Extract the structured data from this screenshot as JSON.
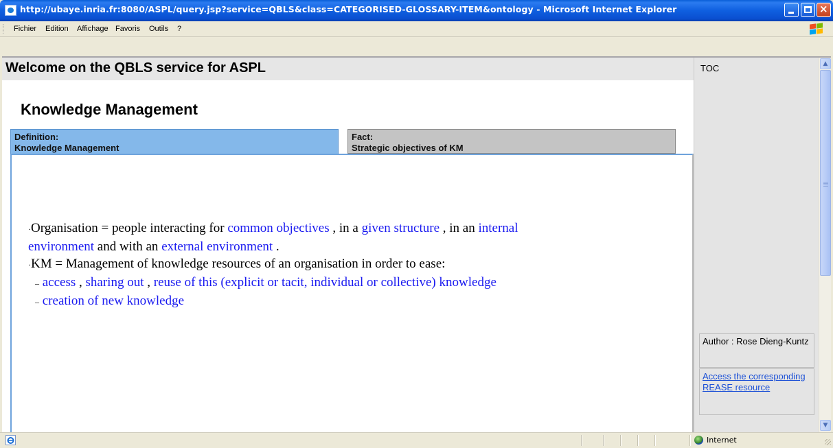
{
  "window": {
    "title": "http://ubaye.inria.fr:8080/ASPL/query.jsp?service=QBLS&class=CATEGORISED-GLOSSARY-ITEM&ontology - Microsoft Internet Explorer"
  },
  "menu": {
    "items": [
      "Fichier",
      "Edition",
      "Affichage",
      "Favoris",
      "Outils",
      "?"
    ]
  },
  "page": {
    "title": "Welcome on the QBLS service for ASPL",
    "subtitle": "Knowledge Management",
    "tabs": [
      {
        "kind": "Definition:",
        "name": "Knowledge Management",
        "active": true
      },
      {
        "kind": "Fact:",
        "name": "Strategic objectives of KM",
        "active": false
      }
    ]
  },
  "content": {
    "bullet": "·",
    "dash": "–",
    "line1": {
      "t1": "Organisation = people interacting for ",
      "l1": "common objectives",
      "t2": " , in a ",
      "l2": "given structure",
      "t3": " , in an ",
      "l3": "internal"
    },
    "line2": {
      "l1": "environment",
      "t1": " and with an ",
      "l2": "external environment",
      "t2": " ."
    },
    "line3": {
      "t1": "KM = Management of knowledge resources of an organisation in order to ease:"
    },
    "line4": {
      "l1": "access",
      "t1": " , ",
      "l2": "sharing out",
      "t2": " , ",
      "l3": "reuse of this (explicit or tacit, individual or collective) knowledge"
    },
    "line5": {
      "l1": "creation of new knowledge"
    }
  },
  "sidebar": {
    "toc_label": "TOC",
    "author": "Author : Rose Dieng-Kuntz",
    "access_link": "Access the corresponding REASE resource"
  },
  "statusbar": {
    "zone": "Internet"
  },
  "colors": {
    "active_tab": "#84b8ea",
    "inactive_tab": "#c4c4c4",
    "link": "#1a1af0",
    "titlebar": "#0a5fd8"
  }
}
